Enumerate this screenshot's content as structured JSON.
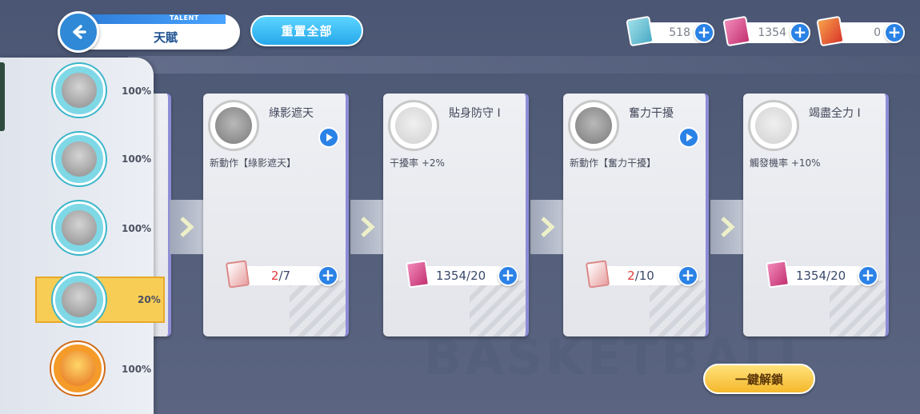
{
  "header": {
    "title_en": "TALENT",
    "title_zh": "天賦",
    "reset_label": "重置全部",
    "back_icon": "arrow-left-icon"
  },
  "currencies": [
    {
      "icon": "blue-card-icon",
      "value": "518",
      "color": "#6cc3d9"
    },
    {
      "icon": "pink-card-icon",
      "value": "1354",
      "color": "#d94c8f"
    },
    {
      "icon": "gold-medal-card-icon",
      "value": "0",
      "color": "#e8562c"
    }
  ],
  "sidebar": {
    "items": [
      {
        "percent": "100%",
        "selected": false
      },
      {
        "percent": "100%",
        "selected": false
      },
      {
        "percent": "100%",
        "selected": false
      },
      {
        "percent": "20%",
        "selected": true
      },
      {
        "percent": "100%",
        "selected": false
      }
    ]
  },
  "cards": [
    {
      "name": "綠影遮天",
      "desc": "新動作【綠影遮天】",
      "has_play": true,
      "cost_current": "2",
      "cost_total": "/7",
      "cost_icon": "player-card-icon",
      "faint": false
    },
    {
      "name": "貼身防守 I",
      "desc": "干擾率 +2%",
      "has_play": false,
      "cost_current": "1354",
      "cost_total": "/20",
      "cost_icon": "pink-card-icon",
      "faint": true
    },
    {
      "name": "奮力干擾",
      "desc": "新動作【奮力干擾】",
      "has_play": true,
      "cost_current": "2",
      "cost_total": "/10",
      "cost_icon": "player-card-icon",
      "faint": false
    },
    {
      "name": "竭盡全力 I",
      "desc": "觸發機率 +10%",
      "has_play": false,
      "cost_current": "1354",
      "cost_total": "/20",
      "cost_icon": "pink-card-icon",
      "faint": true
    }
  ],
  "footer": {
    "unlock_label": "一鍵解鎖"
  },
  "colors": {
    "accent_blue": "#2b82e6",
    "gold": "#f7cd55",
    "cost_red": "#e23a3a"
  }
}
